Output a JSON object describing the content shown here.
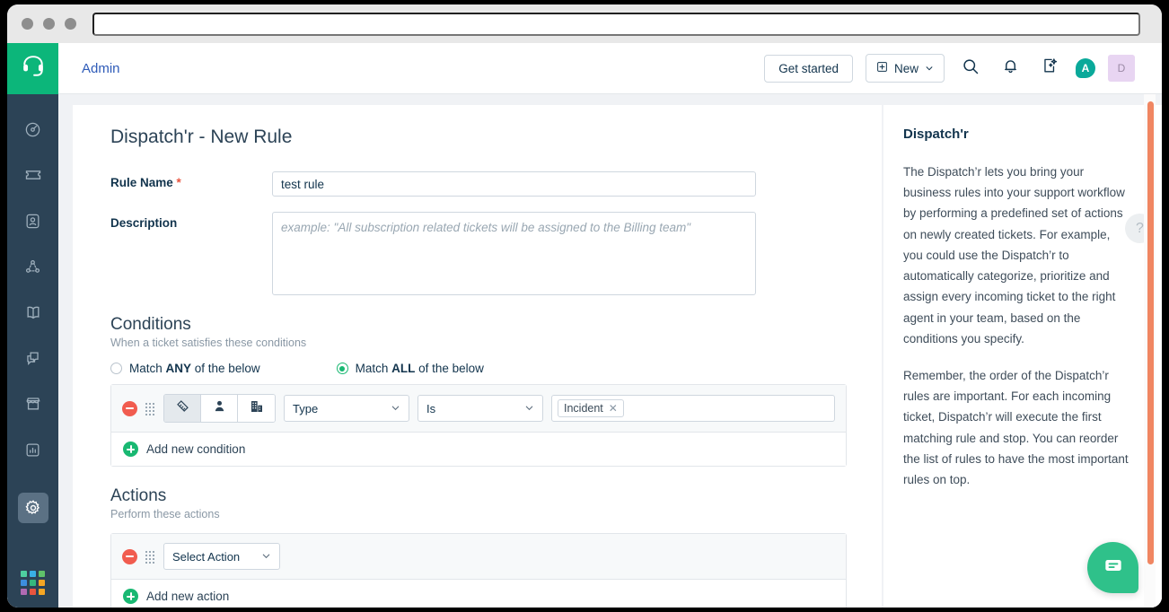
{
  "browser": {
    "url_value": ""
  },
  "topbar": {
    "breadcrumb": "Admin",
    "get_started_label": "Get started",
    "new_label": "New",
    "avatar_teal_initial": "A",
    "avatar_user_initial": "D"
  },
  "sidebar": {
    "logo_icon": "headset-icon",
    "items": [
      {
        "icon": "dashboard-gauge-icon",
        "active": false
      },
      {
        "icon": "ticket-icon",
        "active": false
      },
      {
        "icon": "contact-card-icon",
        "active": false
      },
      {
        "icon": "social-network-icon",
        "active": false
      },
      {
        "icon": "knowledge-base-book-icon",
        "active": false
      },
      {
        "icon": "chat-bubbles-icon",
        "active": false
      },
      {
        "icon": "marketplace-store-icon",
        "active": false
      },
      {
        "icon": "analytics-chart-icon",
        "active": false
      },
      {
        "icon": "gear-icon",
        "active": true
      }
    ],
    "launcher_icon": "app-launcher-grid-icon",
    "launcher_colors": [
      "#4ecfa0",
      "#39b0e5",
      "#5fc26a",
      "#3d8ede",
      "#35b87d",
      "#f5a623",
      "#b06ab3",
      "#e8553f",
      "#f5a623"
    ]
  },
  "page": {
    "title": "Dispatch'r - New Rule",
    "rule_name_label": "Rule Name",
    "rule_name_required_mark": "*",
    "rule_name_value": "test rule",
    "description_label": "Description",
    "description_value": "",
    "description_placeholder": "example: \"All subscription related tickets will be assigned to the Billing team\""
  },
  "conditions": {
    "heading": "Conditions",
    "subheading": "When a ticket satisfies these conditions",
    "match_any_prefix": "Match ",
    "match_any_bold": "ANY",
    "match_any_suffix": " of the below",
    "match_all_prefix": "Match ",
    "match_all_bold": "ALL",
    "match_all_suffix": " of the below",
    "selected_match": "ALL",
    "segments": [
      {
        "icon": "ticket-icon",
        "active": true
      },
      {
        "icon": "contact-person-icon",
        "active": false
      },
      {
        "icon": "company-building-icon",
        "active": false
      }
    ],
    "field_value": "Type",
    "operator_value": "Is",
    "tokens": [
      "Incident"
    ],
    "add_label": "Add new condition"
  },
  "actions": {
    "heading": "Actions",
    "subheading": "Perform these actions",
    "select_action_value": "Select Action",
    "add_label": "Add new action"
  },
  "rightpanel": {
    "title": "Dispatch'r",
    "paragraphs": [
      "The Dispatch’r lets you bring your business rules into your support workflow by performing a predefined set of actions on newly created tickets. For example, you could use the Dispatch’r to automatically categorize, prioritize and assign every incoming ticket to the right agent in your team, based on the conditions you specify.",
      "Remember, the order of the Dispatch’r rules are important. For each incoming ticket, Dispatch’r will execute the first matching rule and stop. You can reorder the list of rules to have the most important rules on top."
    ],
    "help_glyph": "?"
  },
  "chat": {
    "icon": "chat-message-icon"
  },
  "colors": {
    "brand_green": "#0cb67a",
    "rail_navy": "#2c4356",
    "link_blue": "#2e5bb8",
    "danger_red": "#f15c4f",
    "success_green": "#19b872",
    "scrollbar_orange": "#f08662",
    "chat_green": "#2fc18a"
  }
}
